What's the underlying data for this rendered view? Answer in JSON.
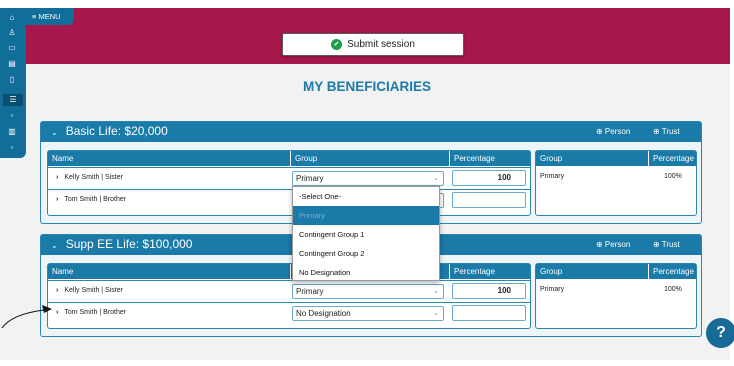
{
  "nav": {
    "menu_label": "≡ MENU",
    "rail_icons": [
      "home-icon",
      "person-add-icon",
      "cards-icon",
      "document-icon",
      "clipboard-icon",
      "list-icon",
      "file-icon",
      "book-icon",
      "file-icon"
    ]
  },
  "actions": {
    "submit_label": "Submit session",
    "submit_icon": "✔"
  },
  "page": {
    "title": "MY BENEFICIARIES"
  },
  "columns": {
    "name": "Name",
    "group": "Group",
    "percentage": "Percentage",
    "right_group": "Group",
    "right_percentage": "Percentage"
  },
  "links": {
    "add_person": "⊕ Person",
    "add_trust": "⊕ Trust"
  },
  "cards": [
    {
      "title": "Basic Life: $20,000",
      "rows": [
        {
          "name": "Kelly Smith | Sister",
          "group": "Primary",
          "percentage": "100"
        },
        {
          "name": "Tom Smith | Brother",
          "group": "",
          "percentage": ""
        }
      ],
      "summary": {
        "group": "Primary",
        "percentage": "100%"
      }
    },
    {
      "title": "Supp EE Life: $100,000",
      "rows": [
        {
          "name": "Kelly Smith | Sister",
          "group": "Primary",
          "percentage": "100"
        },
        {
          "name": "Tom Smith | Brother",
          "group": "No Designation",
          "percentage": ""
        }
      ],
      "summary": {
        "group": "Primary",
        "percentage": "100%"
      }
    }
  ],
  "dropdown": {
    "options": [
      "-Select One-",
      "Primary",
      "Contingent Group 1",
      "Contingent Group 2",
      "No Designation"
    ],
    "highlighted": "Primary"
  },
  "help": {
    "label": "?"
  },
  "colors": {
    "banner": "#a6174b",
    "brand_blue": "#1a7aa8",
    "dark_blue": "#116e99",
    "success": "#1e9e4a"
  }
}
